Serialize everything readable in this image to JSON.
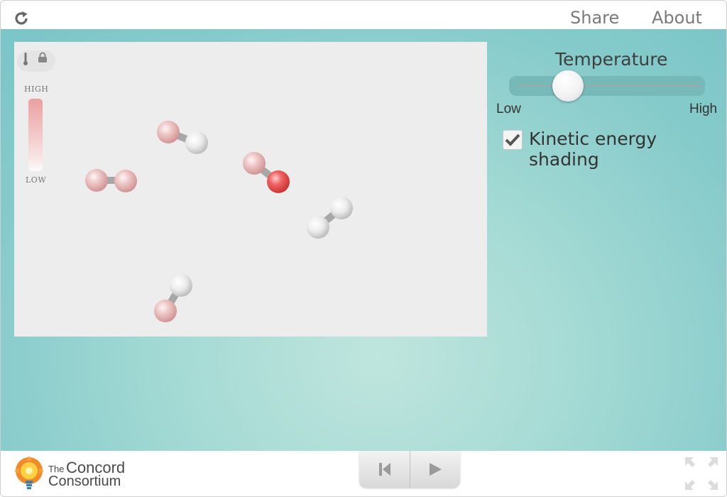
{
  "topbar": {
    "reload_icon": "reload-icon",
    "share_label": "Share",
    "about_label": "About"
  },
  "simulation": {
    "tools": [
      "thermometer-icon",
      "lock-icon"
    ],
    "gauge": {
      "high_label": "HIGH",
      "low_label": "LOW"
    },
    "molecules": [
      {
        "atoms": [
          "pink",
          "pink"
        ]
      },
      {
        "atoms": [
          "pink",
          "white"
        ]
      },
      {
        "atoms": [
          "pink",
          "red"
        ]
      },
      {
        "atoms": [
          "white",
          "white"
        ]
      },
      {
        "atoms": [
          "white",
          "pink"
        ]
      }
    ],
    "colors": {
      "background": "#ededed",
      "bond": "#a7a7a7",
      "hot_atom": "#e0443f",
      "cool_atom": "#efefef"
    }
  },
  "controls": {
    "temperature": {
      "title": "Temperature",
      "min_label": "Low",
      "max_label": "High",
      "value_fraction": 0.28
    },
    "kinetic_energy_shading": {
      "label": "Kinetic energy shading",
      "checked": true
    }
  },
  "footer": {
    "logo": {
      "the": "The",
      "concord": "Concord",
      "consortium": "Consortium",
      "icon": "lightbulb-logo-icon"
    },
    "playback": [
      "reset-to-start-icon",
      "play-icon"
    ],
    "fullscreen_icon": "fullscreen-icon"
  },
  "theme": {
    "teal_background": "#86cbcb",
    "text_gray": "#7a7a7a"
  }
}
